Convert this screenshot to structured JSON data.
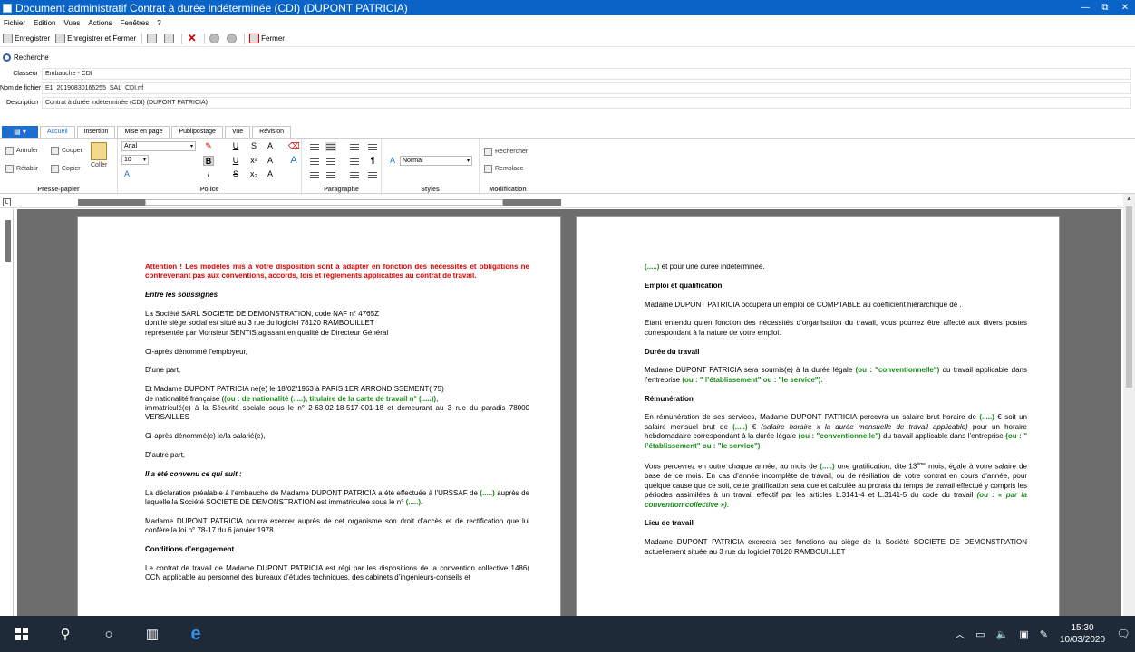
{
  "window": {
    "title": "Document administratif Contrat à durée indéterminée (CDI) (DUPONT PATRICIA)",
    "minimize": "—",
    "restore": "⧉",
    "close": "✕"
  },
  "menu": [
    "Fichier",
    "Edition",
    "Vues",
    "Actions",
    "Fenêtres",
    "?"
  ],
  "toolbar": {
    "save": "Enregistrer",
    "save_close": "Enregistrer et Fermer",
    "close": "Fermer"
  },
  "search": {
    "label": "Recherche"
  },
  "fields": [
    {
      "label": "Classeur",
      "value": "Embauche - CDI"
    },
    {
      "label": "Nom de fichier",
      "value": "E1_20190830165255_SAL_CDI.rtf"
    },
    {
      "label": "Description",
      "value": "Contrat à durée indéterminée (CDI) (DUPONT PATRICIA)"
    }
  ],
  "ribbon": {
    "tabs": [
      "Accueil",
      "Insertion",
      "Mise en page",
      "Publipostage",
      "Vue",
      "Révision"
    ],
    "groups": [
      "Presse-papier",
      "Police",
      "Paragraphe",
      "Styles",
      "Modification"
    ],
    "undo": "Annuler",
    "redo": "Rétablir",
    "cut": "Couper",
    "copy": "Copier",
    "paste": "Coller",
    "font": "Arial",
    "size": "10",
    "style": "Normal",
    "find": "Rechercher",
    "replace": "Remplace"
  },
  "page1": {
    "warning": "Attention ! Les modèles mis à votre disposition sont à adapter en fonction des nécessités et obligations ne contrevenant pas aux conventions, accords, lois et règlements applicables au contrat de travail.",
    "between": "Entre les soussignés",
    "company1": "La Société SARL SOCIETE DE DEMONSTRATION, code NAF n° 4765Z",
    "company2": "dont le siège social est situé au 3 rue du logiciel   78120 RAMBOUILLET",
    "company3": "représentée par  Monsieur  SENTIS,agissant en qualité de Directeur Général",
    "employer": "Ci-après dénommé l’employeur,",
    "oneside": "D’une part,",
    "emp1": "Et  Madame DUPONT PATRICIA né(e) le 18/02/1963 à PARIS 1ER ARRONDISSEMENT( 75)",
    "emp2a": "de nationalité française (",
    "emp2b": "(ou : de nationalité (.....),  titulaire de la carte de travail n° (.....))",
    "emp2c": ",",
    "emp3": "immatriculé(e) à la Sécurité sociale sous le n° 2-63-02-18-517-001-18 et demeurant au 3 rue du paradis 78000 VERSAILLES",
    "employee": "Ci-après dénommé(e) le/la salarié(e),",
    "otherside": "D’autre part,",
    "agreed": "Il a été convenu ce qui suit :",
    "decl1": "La déclaration préalable à l’embauche de Madame DUPONT PATRICIA a été effectuée à l’URSSAF de ",
    "decl_ph1": "(.....)",
    "decl2": " auprès de laquelle la Société SOCIETE DE DEMONSTRATION est immatriculée sous le n° ",
    "decl_ph2": "(.....)",
    "decl3": ".",
    "rights": " Madame DUPONT PATRICIA pourra exercer auprès de cet organisme son droit d’accès et de rectification que lui confère la loi n° 78-17 du 6 janvier 1978.",
    "cond_title": "Conditions d’engagement",
    "cond_text": "Le contrat de travail de Madame DUPONT PATRICIA est régi par les dispositions de la convention collective 1486( CCN applicable au personnel des bureaux d’études techniques, des cabinets d’ingénieurs-conseils et"
  },
  "page2": {
    "p0a": "(.....)",
    "p0b": " et pour une durée indéterminée.",
    "emp_title": "Emploi et qualification",
    "emp_text": " Madame DUPONT PATRICIA occupera un emploi de COMPTABLE au coefficient hiérarchique de .",
    "emp_text2": "Etant entendu qu’en fonction des nécessités d’organisation du travail, vous pourrez être affecté aux divers postes correspondant à la nature de votre emploi.",
    "dur_title": "Durée du travail",
    "dur_a": " Madame DUPONT PATRICIA sera soumis(e) à la durée légale ",
    "dur_b": "(ou : \"conventionnelle\")",
    "dur_c": " du travail applicable dans l’entreprise ",
    "dur_d": "(ou : \" l’établissement\" ou : \"le service\")",
    "dur_e": ".",
    "rem_title": "Rémunération",
    "rem_a": "En rémunération de ses services, Madame DUPONT PATRICIA percevra un salaire brut horaire de ",
    "rem_b": "(.....)",
    "rem_c": " € soit un salaire mensuel brut de ",
    "rem_d": "(.....)",
    "rem_e": " € ",
    "rem_f": "(salaire horaire x la durée mensuelle de travail applicable)",
    "rem_g": " pour un horaire hebdomadaire correspondant à la durée légale ",
    "rem_h": "(ou : \"conventionnelle\")",
    "rem_i": " du travail applicable dans l’entreprise ",
    "rem_j": "(ou : \" l’établissement\" ou : \"le service\")",
    "grat_a": "Vous percevrez en outre chaque année, au mois de ",
    "grat_b": "(.....)",
    "grat_c": " une gratification, dite 13",
    "grat_sup": "ème",
    "grat_d": " mois, égale à votre salaire de base de ce mois. En cas d’année incomplète de travail, ou de résiliation de votre contrat en cours d’année, pour quelque cause que ce soit, cette gratification sera due et calculée au prorata du temps de travail effectué y compris les périodes assimilées à un travail effectif par les articles L.3141-4 et L.3141-5 du code du travail ",
    "grat_e": "(ou : « par la convention collective »)",
    "grat_f": ".",
    "lieu_title": "Lieu de travail",
    "lieu_text": "  Madame DUPONT PATRICIA exercera ses fonctions au siège de la Société SOCIETE DE DEMONSTRATION actuellement située au 3 rue du logiciel   78120 RAMBOUILLET"
  },
  "taskbar": {
    "time": "15:30",
    "date": "10/03/2020"
  }
}
